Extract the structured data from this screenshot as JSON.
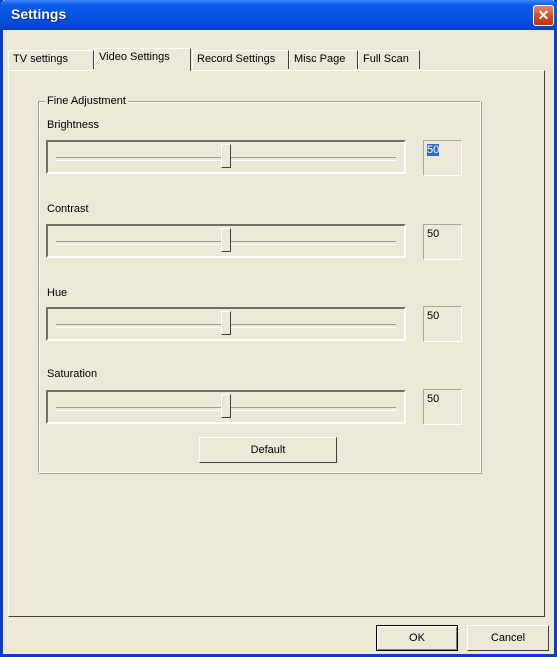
{
  "window": {
    "title": "Settings",
    "close_symbol": "✕"
  },
  "tabs": [
    {
      "label": "TV settings",
      "active": false
    },
    {
      "label": "Video Settings",
      "active": true
    },
    {
      "label": "Record Settings",
      "active": false
    },
    {
      "label": "Misc Page",
      "active": false
    },
    {
      "label": "Full Scan",
      "active": false
    }
  ],
  "fine_adjustment": {
    "group_label": "Fine Adjustment",
    "brightness": {
      "label": "Brightness",
      "value": "50",
      "position": 0.5
    },
    "contrast": {
      "label": "Contrast",
      "value": "50",
      "position": 0.5
    },
    "hue": {
      "label": "Hue",
      "value": "50",
      "position": 0.5
    },
    "saturation": {
      "label": "Saturation",
      "value": "50",
      "position": 0.5
    },
    "default_button": "Default"
  },
  "footer": {
    "ok_label": "OK",
    "cancel_label": "Cancel"
  },
  "colors": {
    "title_bar": "#0553e3",
    "close_button": "#d2421b",
    "face": "#ece9d8",
    "selection": "#316ac5"
  }
}
